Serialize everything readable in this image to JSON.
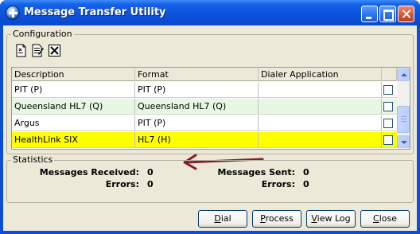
{
  "window": {
    "title": "Message Transfer Utility",
    "app_icon": "globe-cross-icon"
  },
  "configuration": {
    "legend": "Configuration",
    "toolbar": [
      {
        "name": "new-icon"
      },
      {
        "name": "edit-icon"
      },
      {
        "name": "delete-icon"
      }
    ],
    "columns": [
      "Description",
      "Format",
      "Dialer Application",
      ""
    ],
    "rows": [
      {
        "description": "PIT (P)",
        "format": "PIT (P)",
        "dialer": "",
        "checked": false,
        "bg": "#ffffff"
      },
      {
        "description": "Queensland HL7 (Q)",
        "format": "Queensland HL7 (Q)",
        "dialer": "",
        "checked": false,
        "bg": "#e8f7e4"
      },
      {
        "description": "Argus",
        "format": "PIT (P)",
        "dialer": "",
        "checked": false,
        "bg": "#ffffff"
      },
      {
        "description": "HealthLink SIX",
        "format": "HL7 (H)",
        "dialer": "",
        "checked": false,
        "bg": "#ffff00"
      }
    ]
  },
  "statistics": {
    "legend": "Statistics",
    "messages_received_label": "Messages Received:",
    "messages_received": "0",
    "errors_left_label": "Errors:",
    "errors_left": "0",
    "messages_sent_label": "Messages Sent:",
    "messages_sent": "0",
    "errors_right_label": "Errors:",
    "errors_right": "0"
  },
  "buttons": {
    "dial_u": "D",
    "dial_rest": "ial",
    "process_u": "P",
    "process_rest": "rocess",
    "viewlog_u": "V",
    "viewlog_rest": "iew Log",
    "close_u": "C",
    "close_rest": "lose"
  },
  "colors": {
    "titlebar": "#0b52db",
    "selected_row": "#ffff00",
    "alt_row": "#e8f7e4",
    "annotation_arrow": "#8b1a2b"
  }
}
